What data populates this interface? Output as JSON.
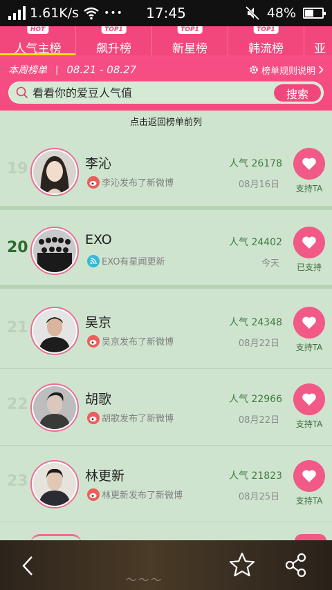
{
  "status_bar": {
    "speed": "1.61K/s",
    "dots": "•••",
    "time": "17:45",
    "battery": "48%",
    "battery_level": 0.48
  },
  "tabs": [
    {
      "label": "人气主榜",
      "badge": "HOT",
      "active": true
    },
    {
      "label": "飙升榜",
      "badge": "TOP1",
      "active": false
    },
    {
      "label": "新星榜",
      "badge": "TOP1",
      "active": false
    },
    {
      "label": "韩流榜",
      "badge": "TOP1",
      "active": false
    },
    {
      "label": "亚洲",
      "badge": "",
      "active": false
    }
  ],
  "header": {
    "week_label": "本周榜单",
    "separator": "|",
    "week_dates": "08.21 - 08.27",
    "rules_link": "榜单规则说明"
  },
  "search": {
    "placeholder": "看看你的爱豆人气值",
    "button": "搜索"
  },
  "back_to_top": "点击返回榜单前列",
  "entries": [
    {
      "rank": "19",
      "name": "李沁",
      "update": "李沁发布了新微博",
      "popularity": "人气 26178",
      "date": "08月16日",
      "support": "支持TA",
      "source": "weibo"
    },
    {
      "rank": "20",
      "name": "EXO",
      "update": "EXO有星闻更新",
      "popularity": "人气 24402",
      "date": "今天",
      "support": "已支持",
      "source": "news"
    },
    {
      "rank": "21",
      "name": "吴京",
      "update": "吴京发布了新微博",
      "popularity": "人气 24348",
      "date": "08月22日",
      "support": "支持TA",
      "source": "weibo"
    },
    {
      "rank": "22",
      "name": "胡歌",
      "update": "胡歌发布了新微博",
      "popularity": "人气 22966",
      "date": "08月22日",
      "support": "支持TA",
      "source": "weibo"
    },
    {
      "rank": "23",
      "name": "林更新",
      "update": "林更新发布了新微博",
      "popularity": "人气 21823",
      "date": "08月25日",
      "support": "支持TA",
      "source": "weibo"
    }
  ],
  "colors": {
    "accent": "#f2477c",
    "background": "#cfe4cf",
    "popularity_text": "#3f7a3f"
  },
  "bottom_nav": {
    "icons": [
      "back-icon",
      "star-icon",
      "share-icon"
    ]
  }
}
